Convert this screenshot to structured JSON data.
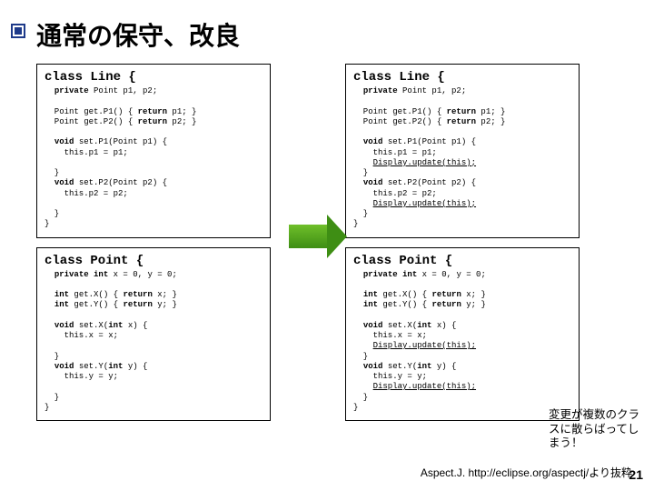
{
  "title": "通常の保守、改良",
  "left": {
    "line": {
      "sig": "class Line {",
      "body": "  private Point p1, p2;\n\n  Point get.P1() { return p1; }\n  Point get.P2() { return p2; }\n\n  void set.P1(Point p1) {\n    this.p1 = p1;\n\n  }\n  void set.P2(Point p2) {\n    this.p2 = p2;\n\n  }\n}"
    },
    "point": {
      "sig": "class Point {",
      "body": "  private int x = 0, y = 0;\n\n  int get.X() { return x; }\n  int get.Y() { return y; }\n\n  void set.X(int x) {\n    this.x = x;\n\n  }\n  void set.Y(int y) {\n    this.y = y;\n\n  }\n}"
    }
  },
  "right": {
    "line": {
      "sig": "class Line {",
      "body": "  private Point p1, p2;\n\n  Point get.P1() { return p1; }\n  Point get.P2() { return p2; }\n\n  void set.P1(Point p1) {\n    this.p1 = p1;\n    Display.update(this);\n  }\n  void set.P2(Point p2) {\n    this.p2 = p2;\n    Display.update(this);\n  }\n}"
    },
    "point": {
      "sig": "class Point {",
      "body": "  private int x = 0, y = 0;\n\n  int get.X() { return x; }\n  int get.Y() { return y; }\n\n  void set.X(int x) {\n    this.x = x;\n    Display.update(this);\n  }\n  void set.Y(int y) {\n    this.y = y;\n    Display.update(this);\n  }\n}"
    }
  },
  "note": "変更が複数のクラスに散らばってしまう！",
  "citation": "Aspect.J. http://eclipse.org/aspectj/より抜粋",
  "page_number": "21"
}
